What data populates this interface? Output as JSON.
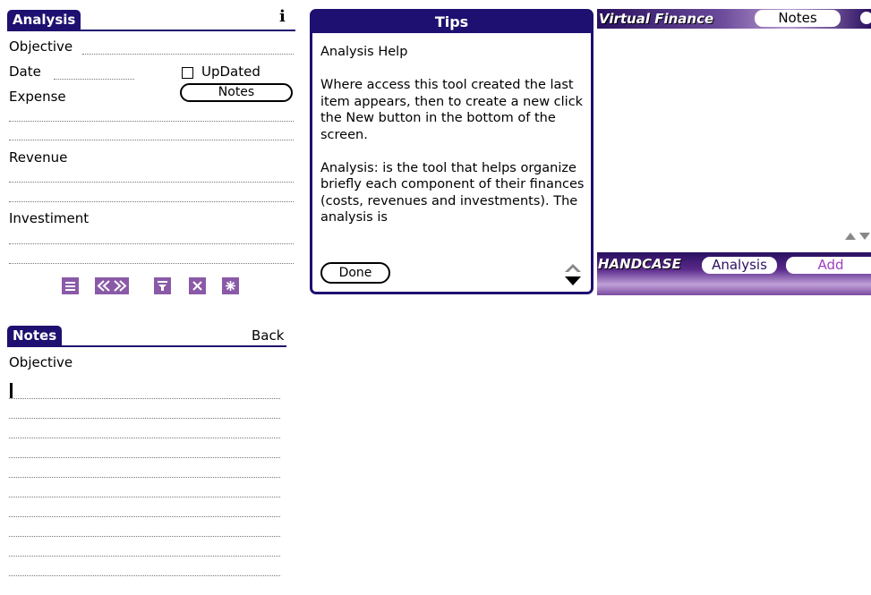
{
  "analysis": {
    "title": "Analysis",
    "info_glyph": "i",
    "objective_label": "Objective",
    "date_label": "Date",
    "updated_label": "UpDated",
    "updated_checked": false,
    "expense_label": "Expense",
    "notes_button": "Notes",
    "revenue_label": "Revenue",
    "investment_label": "Investiment",
    "toolbar_icons": [
      "list-icon",
      "prev-next-icon",
      "filter-icon",
      "delete-icon",
      "new-icon"
    ]
  },
  "tips": {
    "title": "Tips",
    "heading": "Analysis Help",
    "paragraph1": "Where access this tool created the last item appears, then to create a new click the New button in the bottom of the screen.",
    "paragraph2": "Analysis: is the tool that helps organize briefly each component of their finances (costs, revenues and investments). The analysis is",
    "done_button": "Done"
  },
  "virtual_finance": {
    "app_title": "Virtual Finance",
    "notes_tab": "Notes",
    "brand": "HANDCASE",
    "analysis_tab": "Analysis",
    "add_tab": "Add",
    "colors": {
      "dark": "#2a1060",
      "accent": "#8a5aa8",
      "tab_text_add": "#a040c0"
    }
  },
  "notes": {
    "title": "Notes",
    "back_button": "Back",
    "field_label": "Objective"
  }
}
